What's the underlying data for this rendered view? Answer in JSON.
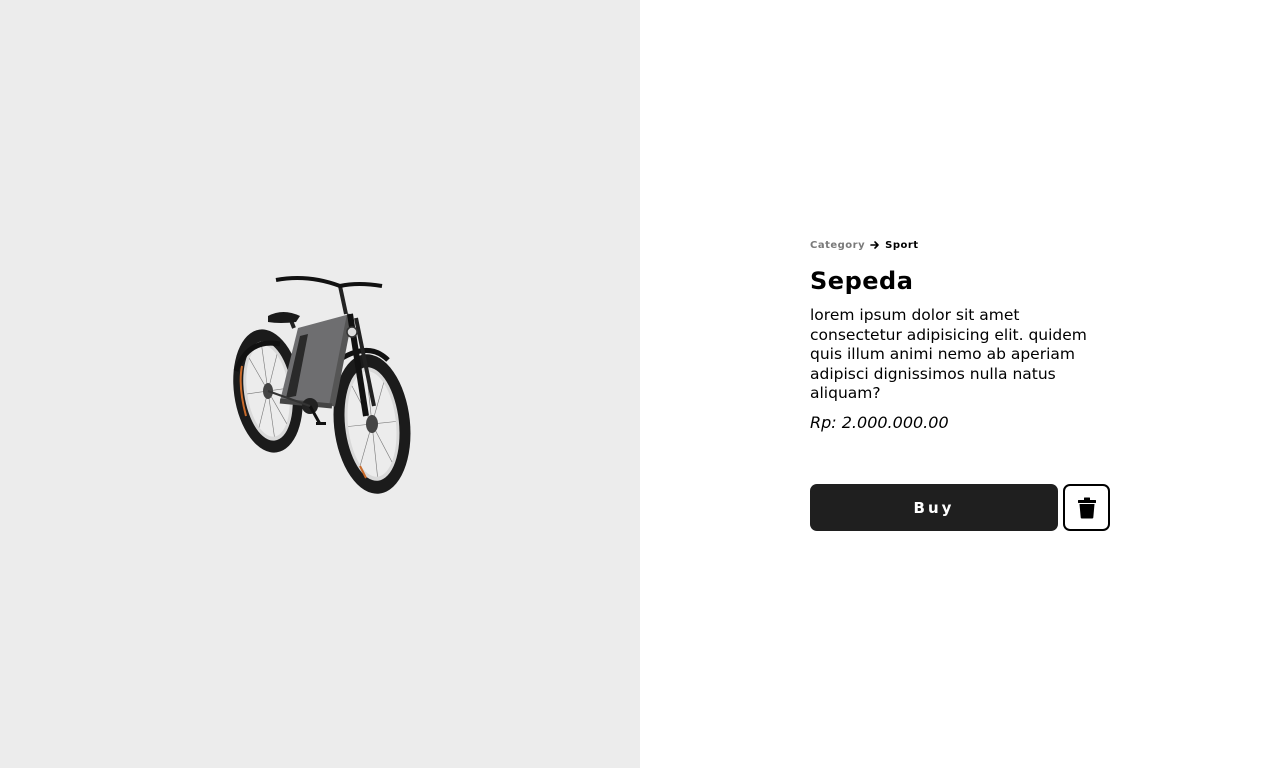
{
  "product": {
    "breadcrumb": {
      "category_label": "Category",
      "separator_icon": "arrow-right-icon",
      "current": "Sport"
    },
    "title": "Sepeda",
    "description": "lorem ipsum dolor sit amet consectetur adipisicing elit. quidem quis illum animi nemo ab aperiam adipisci dignissimos nulla natus aliquam?",
    "price": "Rp: 2.000.000.00",
    "image_icon": "bicycle-image"
  },
  "actions": {
    "buy_label": "Buy",
    "delete_icon": "trash-icon"
  },
  "colors": {
    "image_background": "#ececec",
    "button_dark": "#1f1f1f",
    "muted_text": "#7a7a7a"
  }
}
